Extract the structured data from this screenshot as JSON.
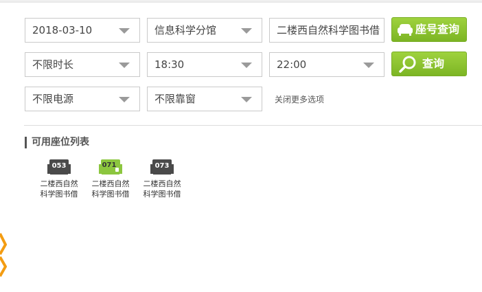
{
  "filters": {
    "date": "2018-03-10",
    "building": "信息科学分馆",
    "room": "二楼西自然科学图书借",
    "duration": "不限时长",
    "start_time": "18:30",
    "end_time": "22:00",
    "power": "不限电源",
    "window": "不限靠窗"
  },
  "buttons": {
    "seat_lookup": "座号查询",
    "search": "查询"
  },
  "more_options_link": "关闭更多选项",
  "seat_list": {
    "title": "可用座位列表",
    "seats": [
      {
        "number": "053",
        "name_line1": "二楼西自然",
        "name_line2": "科学图书借",
        "status_color": "#4a4a4a"
      },
      {
        "number": "071",
        "name_line1": "二楼西自然",
        "name_line2": "科学图书借",
        "status_color": "#8cc63f"
      },
      {
        "number": "073",
        "name_line1": "二楼西自然",
        "name_line2": "科学图书借",
        "status_color": "#4a4a4a"
      }
    ]
  },
  "colors": {
    "accent_green": "#8cc63f",
    "edge_decoration": "#f39c12"
  }
}
